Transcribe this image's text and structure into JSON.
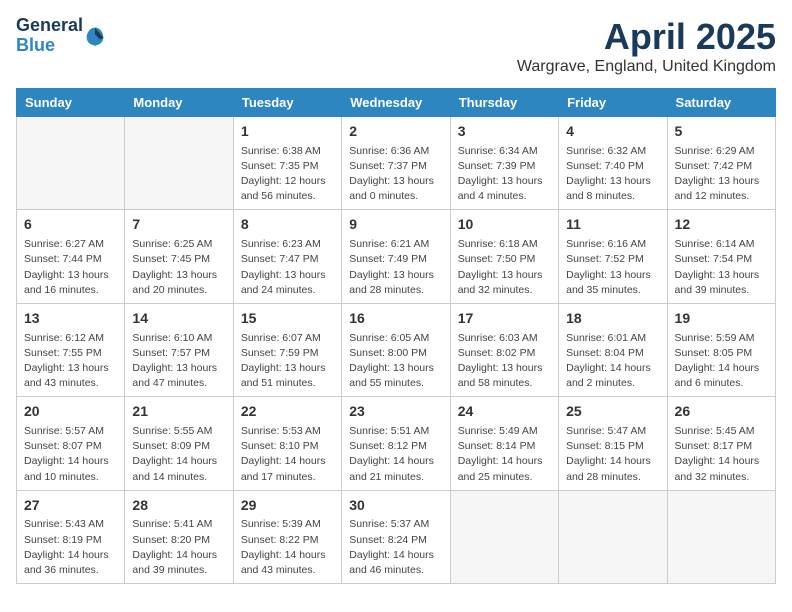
{
  "header": {
    "logo_general": "General",
    "logo_blue": "Blue",
    "month_title": "April 2025",
    "location": "Wargrave, England, United Kingdom"
  },
  "weekdays": [
    "Sunday",
    "Monday",
    "Tuesday",
    "Wednesday",
    "Thursday",
    "Friday",
    "Saturday"
  ],
  "weeks": [
    [
      {
        "day": "",
        "info": ""
      },
      {
        "day": "",
        "info": ""
      },
      {
        "day": "1",
        "info": "Sunrise: 6:38 AM\nSunset: 7:35 PM\nDaylight: 12 hours and 56 minutes."
      },
      {
        "day": "2",
        "info": "Sunrise: 6:36 AM\nSunset: 7:37 PM\nDaylight: 13 hours and 0 minutes."
      },
      {
        "day": "3",
        "info": "Sunrise: 6:34 AM\nSunset: 7:39 PM\nDaylight: 13 hours and 4 minutes."
      },
      {
        "day": "4",
        "info": "Sunrise: 6:32 AM\nSunset: 7:40 PM\nDaylight: 13 hours and 8 minutes."
      },
      {
        "day": "5",
        "info": "Sunrise: 6:29 AM\nSunset: 7:42 PM\nDaylight: 13 hours and 12 minutes."
      }
    ],
    [
      {
        "day": "6",
        "info": "Sunrise: 6:27 AM\nSunset: 7:44 PM\nDaylight: 13 hours and 16 minutes."
      },
      {
        "day": "7",
        "info": "Sunrise: 6:25 AM\nSunset: 7:45 PM\nDaylight: 13 hours and 20 minutes."
      },
      {
        "day": "8",
        "info": "Sunrise: 6:23 AM\nSunset: 7:47 PM\nDaylight: 13 hours and 24 minutes."
      },
      {
        "day": "9",
        "info": "Sunrise: 6:21 AM\nSunset: 7:49 PM\nDaylight: 13 hours and 28 minutes."
      },
      {
        "day": "10",
        "info": "Sunrise: 6:18 AM\nSunset: 7:50 PM\nDaylight: 13 hours and 32 minutes."
      },
      {
        "day": "11",
        "info": "Sunrise: 6:16 AM\nSunset: 7:52 PM\nDaylight: 13 hours and 35 minutes."
      },
      {
        "day": "12",
        "info": "Sunrise: 6:14 AM\nSunset: 7:54 PM\nDaylight: 13 hours and 39 minutes."
      }
    ],
    [
      {
        "day": "13",
        "info": "Sunrise: 6:12 AM\nSunset: 7:55 PM\nDaylight: 13 hours and 43 minutes."
      },
      {
        "day": "14",
        "info": "Sunrise: 6:10 AM\nSunset: 7:57 PM\nDaylight: 13 hours and 47 minutes."
      },
      {
        "day": "15",
        "info": "Sunrise: 6:07 AM\nSunset: 7:59 PM\nDaylight: 13 hours and 51 minutes."
      },
      {
        "day": "16",
        "info": "Sunrise: 6:05 AM\nSunset: 8:00 PM\nDaylight: 13 hours and 55 minutes."
      },
      {
        "day": "17",
        "info": "Sunrise: 6:03 AM\nSunset: 8:02 PM\nDaylight: 13 hours and 58 minutes."
      },
      {
        "day": "18",
        "info": "Sunrise: 6:01 AM\nSunset: 8:04 PM\nDaylight: 14 hours and 2 minutes."
      },
      {
        "day": "19",
        "info": "Sunrise: 5:59 AM\nSunset: 8:05 PM\nDaylight: 14 hours and 6 minutes."
      }
    ],
    [
      {
        "day": "20",
        "info": "Sunrise: 5:57 AM\nSunset: 8:07 PM\nDaylight: 14 hours and 10 minutes."
      },
      {
        "day": "21",
        "info": "Sunrise: 5:55 AM\nSunset: 8:09 PM\nDaylight: 14 hours and 14 minutes."
      },
      {
        "day": "22",
        "info": "Sunrise: 5:53 AM\nSunset: 8:10 PM\nDaylight: 14 hours and 17 minutes."
      },
      {
        "day": "23",
        "info": "Sunrise: 5:51 AM\nSunset: 8:12 PM\nDaylight: 14 hours and 21 minutes."
      },
      {
        "day": "24",
        "info": "Sunrise: 5:49 AM\nSunset: 8:14 PM\nDaylight: 14 hours and 25 minutes."
      },
      {
        "day": "25",
        "info": "Sunrise: 5:47 AM\nSunset: 8:15 PM\nDaylight: 14 hours and 28 minutes."
      },
      {
        "day": "26",
        "info": "Sunrise: 5:45 AM\nSunset: 8:17 PM\nDaylight: 14 hours and 32 minutes."
      }
    ],
    [
      {
        "day": "27",
        "info": "Sunrise: 5:43 AM\nSunset: 8:19 PM\nDaylight: 14 hours and 36 minutes."
      },
      {
        "day": "28",
        "info": "Sunrise: 5:41 AM\nSunset: 8:20 PM\nDaylight: 14 hours and 39 minutes."
      },
      {
        "day": "29",
        "info": "Sunrise: 5:39 AM\nSunset: 8:22 PM\nDaylight: 14 hours and 43 minutes."
      },
      {
        "day": "30",
        "info": "Sunrise: 5:37 AM\nSunset: 8:24 PM\nDaylight: 14 hours and 46 minutes."
      },
      {
        "day": "",
        "info": ""
      },
      {
        "day": "",
        "info": ""
      },
      {
        "day": "",
        "info": ""
      }
    ]
  ]
}
